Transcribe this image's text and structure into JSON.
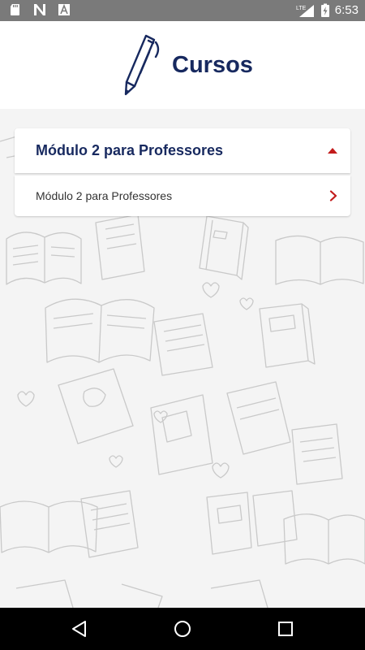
{
  "status_bar": {
    "time": "6:53",
    "network": "LTE",
    "icons": [
      "sd-card-icon",
      "n-notification-icon",
      "a-notification-icon",
      "signal-icon",
      "battery-charging-icon"
    ]
  },
  "header": {
    "title": "Cursos",
    "icon": "pencil-icon"
  },
  "accordion": {
    "section_title": "Módulo 2 para Professores",
    "expanded": true,
    "items": [
      {
        "label": "Módulo 2 para Professores"
      }
    ]
  },
  "colors": {
    "primary_navy": "#17295f",
    "accent_red": "#c21b1b",
    "status_bar": "#7a7a7a",
    "nav_bar": "#000000"
  },
  "nav_bar": {
    "buttons": [
      "back-icon",
      "home-icon",
      "recents-icon"
    ]
  }
}
